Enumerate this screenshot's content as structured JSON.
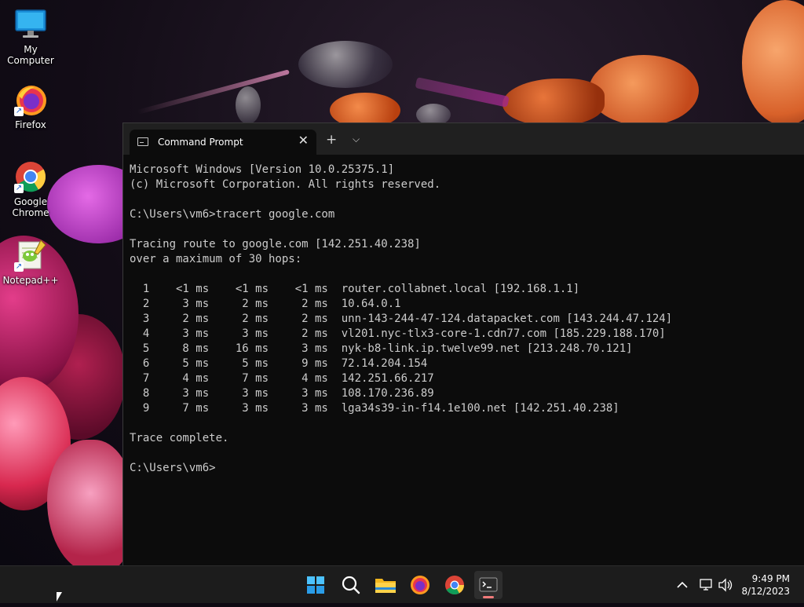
{
  "desktop": {
    "icons": [
      {
        "label": "My Computer"
      },
      {
        "label": "Firefox"
      },
      {
        "label": "Google Chrome"
      },
      {
        "label": "Notepad++"
      }
    ]
  },
  "terminal": {
    "tab_title": "Command Prompt",
    "lines": [
      "Microsoft Windows [Version 10.0.25375.1]",
      "(c) Microsoft Corporation. All rights reserved.",
      "",
      "C:\\Users\\vm6>tracert google.com",
      "",
      "Tracing route to google.com [142.251.40.238]",
      "over a maximum of 30 hops:",
      "",
      "  1    <1 ms    <1 ms    <1 ms  router.collabnet.local [192.168.1.1]",
      "  2     3 ms     2 ms     2 ms  10.64.0.1",
      "  3     2 ms     2 ms     2 ms  unn-143-244-47-124.datapacket.com [143.244.47.124]",
      "  4     3 ms     3 ms     2 ms  vl201.nyc-tlx3-core-1.cdn77.com [185.229.188.170]",
      "  5     8 ms    16 ms     3 ms  nyk-b8-link.ip.twelve99.net [213.248.70.121]",
      "  6     5 ms     5 ms     9 ms  72.14.204.154",
      "  7     4 ms     7 ms     4 ms  142.251.66.217",
      "  8     3 ms     3 ms     3 ms  108.170.236.89",
      "  9     7 ms     3 ms     3 ms  lga34s39-in-f14.1e100.net [142.251.40.238]",
      "",
      "Trace complete.",
      "",
      "C:\\Users\\vm6>"
    ]
  },
  "taskbar": {
    "apps": [
      "start-icon",
      "search-icon",
      "file-explorer-icon",
      "firefox-icon",
      "chrome-icon",
      "terminal-icon"
    ],
    "time": "9:49 PM",
    "date": "8/12/2023"
  }
}
